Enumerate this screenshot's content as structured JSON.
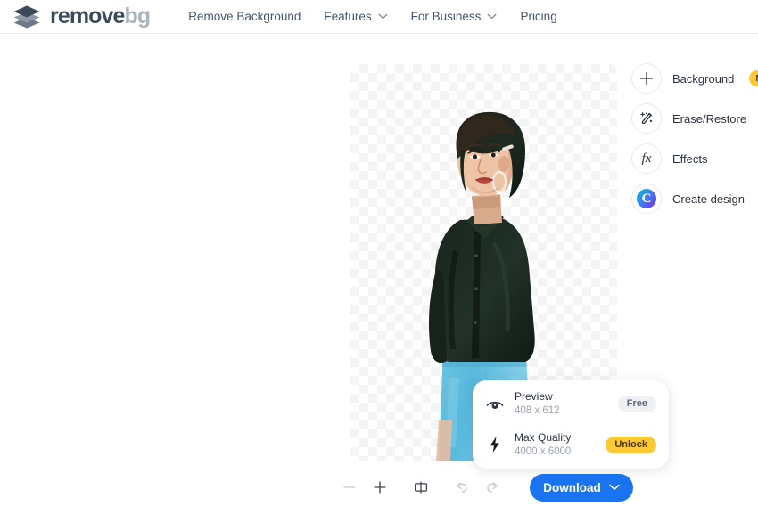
{
  "brand": {
    "name_dark": "remove",
    "name_gray": "bg",
    "logo_icon": "layers-diamond-icon"
  },
  "nav": {
    "items": [
      {
        "label": "Remove Background",
        "has_dropdown": false
      },
      {
        "label": "Features",
        "has_dropdown": true
      },
      {
        "label": "For Business",
        "has_dropdown": true
      },
      {
        "label": "Pricing",
        "has_dropdown": false
      }
    ]
  },
  "canvas": {
    "image_alt": "woman-with-short-dark-hair-in-dark-green-shirt-and-light-blue-jeans",
    "background": "transparent-checkerboard"
  },
  "quality_card": {
    "rows": [
      {
        "icon": "eye-icon",
        "title": "Preview",
        "dimensions": "408 x 612",
        "badge": "Free",
        "badge_style": "neutral"
      },
      {
        "icon": "lightning-bolt-icon",
        "title": "Max Quality",
        "dimensions": "4000 x 6000",
        "badge": "Unlock",
        "badge_style": "premium"
      }
    ]
  },
  "sidebar": {
    "items": [
      {
        "label": "Background",
        "icon": "plus-icon",
        "badge": "New"
      },
      {
        "label": "Erase/Restore",
        "icon": "magic-wand-icon",
        "badge": ""
      },
      {
        "label": "Effects",
        "icon": "fx-icon",
        "badge": ""
      },
      {
        "label": "Create design",
        "icon": "canva-logo-icon",
        "badge": ""
      }
    ]
  },
  "toolbar": {
    "zoom_out": "minus-icon",
    "zoom_in": "plus-icon",
    "compare": "compare-split-icon",
    "undo": "undo-arrow-icon",
    "redo": "redo-arrow-icon",
    "download_label": "Download",
    "download_chevron": "chevron-down-icon"
  },
  "colors": {
    "accent_blue": "#1a73f0",
    "badge_yellow": "#fcc934",
    "logo_dark": "#3c4b5c",
    "logo_gray": "#aab4be",
    "text_primary": "#2c3442",
    "text_muted": "#9aa4b2"
  }
}
